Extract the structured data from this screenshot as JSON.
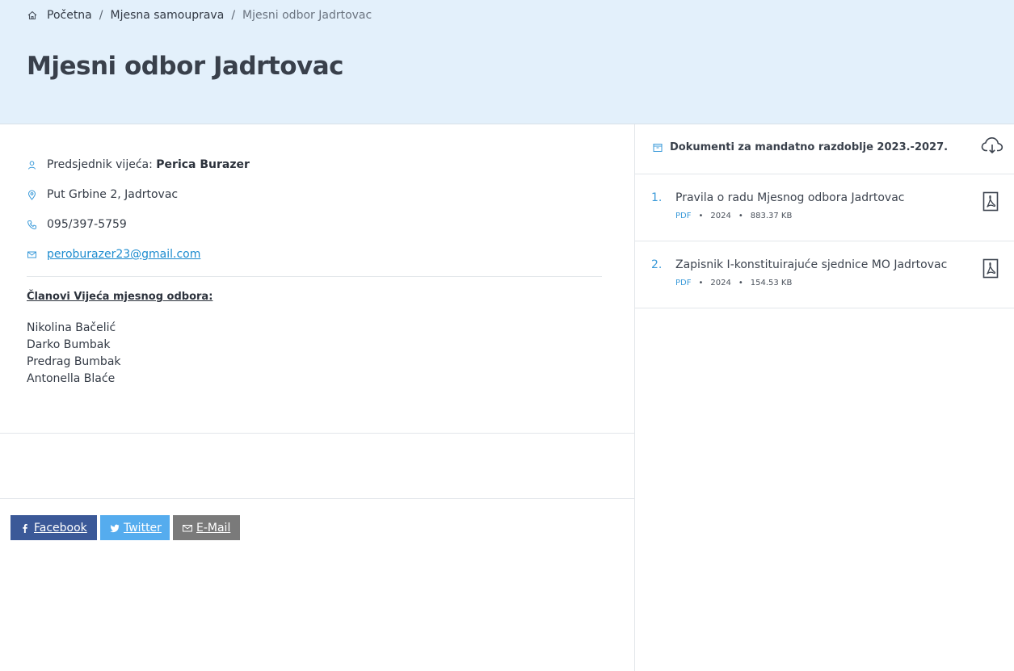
{
  "breadcrumb": {
    "home": "Početna",
    "section": "Mjesna samouprava",
    "current": "Mjesni odbor Jadrtovac",
    "separator": "/"
  },
  "page": {
    "title": "Mjesni odbor Jadrtovac"
  },
  "contact": {
    "president_label": "Predsjednik vijeća:",
    "president_name": "Perica Burazer",
    "address": "Put Grbine 2, Jadrtovac",
    "phone": "095/397-5759",
    "email": "peroburazer23@gmail.com"
  },
  "members": {
    "title": "Članovi Vijeća mjesnog odbora:",
    "list": [
      "Nikolina Bačelić",
      "Darko Bumbak",
      "Predrag Bumbak",
      "Antonella Blaće"
    ]
  },
  "share": {
    "facebook": "Facebook",
    "twitter": "Twitter",
    "email": "E-Mail"
  },
  "documents": {
    "title": "Dokumenti za mandatno razdoblje 2023.-2027.",
    "items": [
      {
        "num": "1.",
        "name": "Pravila o radu Mjesnog odbora Jadrtovac",
        "type": "PDF",
        "year": "2024",
        "size": "883.37 KB"
      },
      {
        "num": "2.",
        "name": "Zapisnik I-konstituirajuće sjednice MO Jadrtovac",
        "type": "PDF",
        "year": "2024",
        "size": "154.53 KB"
      }
    ]
  },
  "colors": {
    "hero_bg": "#e3f0fb",
    "accent": "#1d8ccf",
    "facebook": "#3b5998",
    "twitter": "#55acee",
    "email": "#7a7a7a"
  }
}
